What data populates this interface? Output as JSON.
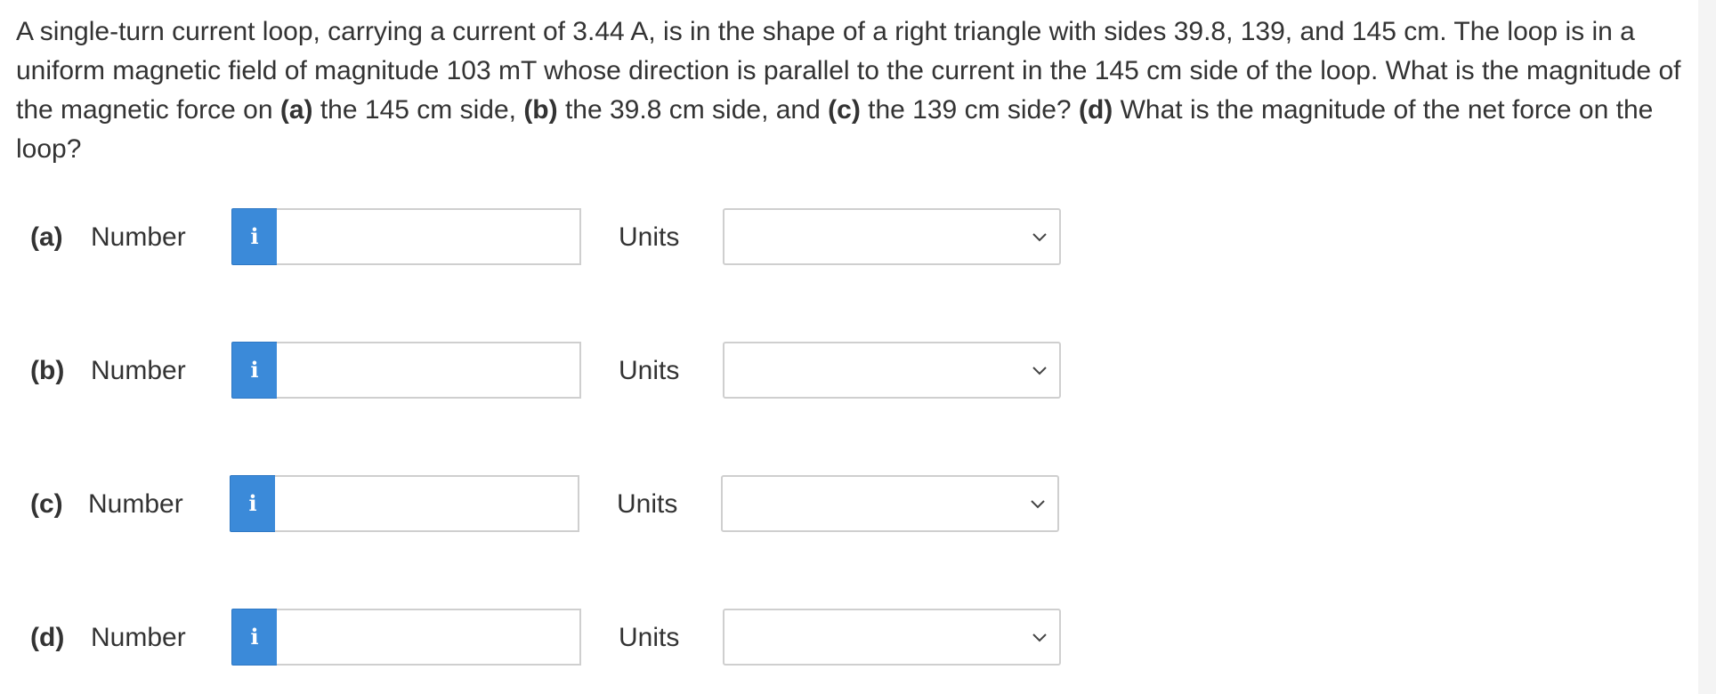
{
  "question": {
    "text_1": "A single-turn current loop, carrying a current of 3.44 A, is in the shape of a right triangle with sides 39.8, 139, and 145 cm. The loop is in a uniform magnetic field of magnitude 103 mT whose direction is parallel to the current in the 145 cm side of the loop. What is the magnitude of the magnetic force on ",
    "part_a": "(a)",
    "text_2": " the 145 cm side, ",
    "part_b": "(b)",
    "text_3": " the 39.8 cm side, and ",
    "part_c": "(c)",
    "text_4": " the 139 cm side? ",
    "part_d": "(d)",
    "text_5": " What is the magnitude of the net force on the loop?"
  },
  "answers": [
    {
      "part": "(a)",
      "number_label": "Number",
      "info_icon": "i",
      "number_value": "",
      "units_label": "Units",
      "units_value": ""
    },
    {
      "part": "(b)",
      "number_label": "Number",
      "info_icon": "i",
      "number_value": "",
      "units_label": "Units",
      "units_value": ""
    },
    {
      "part": "(c)",
      "number_label": "Number",
      "info_icon": "i",
      "number_value": "",
      "units_label": "Units",
      "units_value": ""
    },
    {
      "part": "(d)",
      "number_label": "Number",
      "info_icon": "i",
      "number_value": "",
      "units_label": "Units",
      "units_value": ""
    }
  ],
  "icons": {
    "info": "info-icon",
    "dropdown": "chevron-down-icon"
  },
  "colors": {
    "info_button": "#3b8ad9",
    "text": "#333333",
    "border": "#cfcfcf"
  }
}
